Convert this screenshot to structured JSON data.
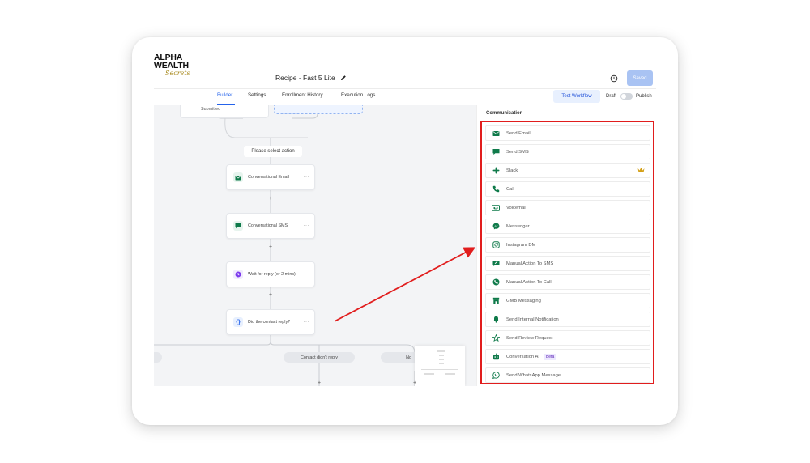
{
  "header": {
    "logo_top": "ALPHA WEALTH",
    "logo_script": "Secrets",
    "workflow_title": "Recipe - Fast 5 Lite",
    "saved_label": "Saved"
  },
  "tabs": [
    {
      "label": "Builder",
      "active": true
    },
    {
      "label": "Settings"
    },
    {
      "label": "Enrollment History"
    },
    {
      "label": "Execution Logs"
    }
  ],
  "toolbar": {
    "test_label": "Test Workflow",
    "draft_label": "Draft",
    "publish_label": "Publish"
  },
  "canvas": {
    "top_node_text": "Submitted",
    "select_action_label": "Please select action",
    "nodes": [
      {
        "label": "Conversational Email",
        "icon": "envelope-icon",
        "color": "#0f7a4a"
      },
      {
        "label": "Conversational SMS",
        "icon": "chat-icon",
        "color": "#0f7a4a"
      },
      {
        "label": "Wait for reply (or 2 mins)",
        "icon": "clock-icon",
        "color": "#7c3aed"
      },
      {
        "label": "Did the contact reply?",
        "icon": "braces-icon",
        "color": "#2563eb"
      }
    ],
    "branch_labels": [
      "Contact didn't reply",
      "No"
    ]
  },
  "panel": {
    "section_title": "Communication",
    "items": [
      {
        "label": "Send Email",
        "icon": "envelope-icon"
      },
      {
        "label": "Send SMS",
        "icon": "chat-icon"
      },
      {
        "label": "Slack",
        "icon": "slack-icon",
        "premium": true
      },
      {
        "label": "Call",
        "icon": "phone-icon"
      },
      {
        "label": "Voicemail",
        "icon": "voicemail-icon"
      },
      {
        "label": "Messenger",
        "icon": "messenger-icon"
      },
      {
        "label": "Instagram DM",
        "icon": "instagram-icon"
      },
      {
        "label": "Manual Action To SMS",
        "icon": "manual-sms-icon"
      },
      {
        "label": "Manual Action To Call",
        "icon": "manual-call-icon"
      },
      {
        "label": "GMB Messaging",
        "icon": "store-icon"
      },
      {
        "label": "Send Internal Notification",
        "icon": "bell-icon"
      },
      {
        "label": "Send Review Request",
        "icon": "star-icon"
      },
      {
        "label": "Conversation AI",
        "icon": "robot-icon",
        "badge": "Beta"
      },
      {
        "label": "Send WhatsApp Message",
        "icon": "whatsapp-icon"
      }
    ]
  },
  "colors": {
    "accent": "#2563eb",
    "icon_green": "#0f7a4a",
    "highlight_red": "#e11d1d"
  }
}
